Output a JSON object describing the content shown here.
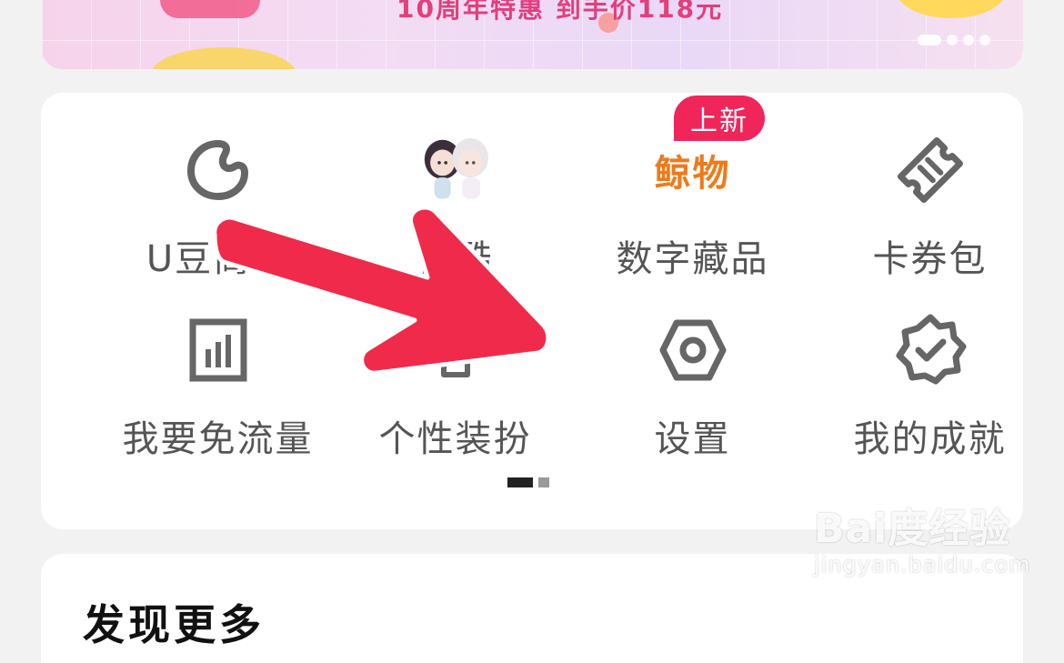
{
  "banner": {
    "promo_text": "10周年特惠 到手价118元",
    "carousel_pages": 4,
    "active_page": 1
  },
  "menu": {
    "badge_new": "上新",
    "items": [
      {
        "label": "U豆商城",
        "icon": "u-bean-icon"
      },
      {
        "label": "优酷",
        "icon": "avatar-characters-icon"
      },
      {
        "label": "数字藏品",
        "icon": "digital-collectible-logo",
        "logo_text": "鲸物"
      },
      {
        "label": "卡券包",
        "icon": "ticket-icon"
      },
      {
        "label": "我要免流量",
        "icon": "data-plan-icon"
      },
      {
        "label": "个性装扮",
        "icon": "theme-icon"
      },
      {
        "label": "设置",
        "icon": "settings-hexagon-icon"
      },
      {
        "label": "我的成就",
        "icon": "achievement-badge-icon"
      }
    ],
    "page_indicator": {
      "pages": 2,
      "active": 1
    }
  },
  "section2": {
    "title": "发现更多"
  },
  "watermark": {
    "brand": "Bai度经验",
    "url": "jingyan.baidu.com"
  },
  "colors": {
    "accent": "#f0255a",
    "arrow": "#f02a4a",
    "icon_gray": "#666666",
    "collectible_orange": "#f07a1a"
  }
}
